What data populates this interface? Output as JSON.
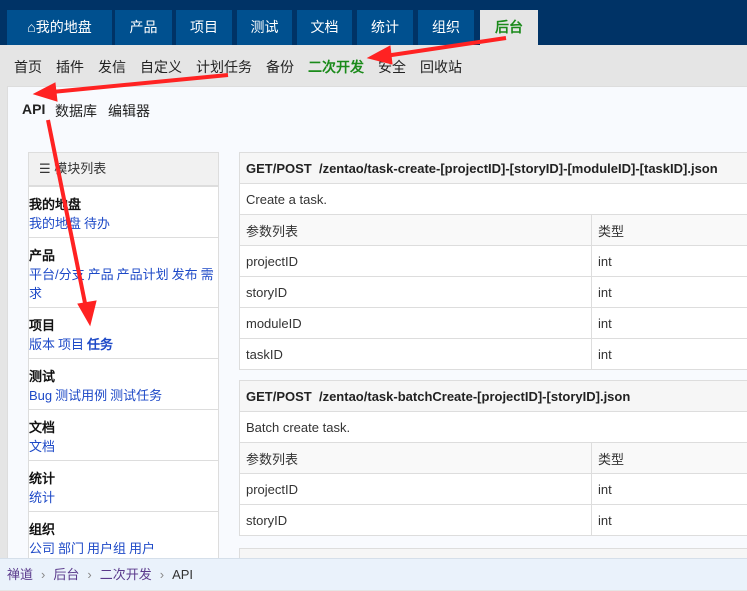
{
  "top_tabs": [
    "我的地盘",
    "产品",
    "项目",
    "测试",
    "文档",
    "统计",
    "组织",
    "后台"
  ],
  "active_tab": "后台",
  "sub_nav": [
    "首页",
    "插件",
    "发信",
    "自定义",
    "计划任务",
    "备份",
    "二次开发",
    "安全",
    "回收站"
  ],
  "active_sub": "二次开发",
  "dev_tabs": [
    "API",
    "数据库",
    "编辑器"
  ],
  "sidebar": {
    "title": "模块列表",
    "sections": [
      {
        "title": "我的地盘",
        "links": [
          "我的地盘",
          "待办"
        ]
      },
      {
        "title": "产品",
        "links": [
          "平台/分支",
          "产品",
          "产品计划",
          "发布",
          "需求"
        ]
      },
      {
        "title": "项目",
        "links": [
          "版本",
          "项目",
          "任务"
        ]
      },
      {
        "title": "测试",
        "links": [
          "Bug",
          "测试用例",
          "测试任务"
        ]
      },
      {
        "title": "文档",
        "links": [
          "文档"
        ]
      },
      {
        "title": "统计",
        "links": [
          "统计"
        ]
      },
      {
        "title": "组织",
        "links": [
          "公司",
          "部门",
          "用户组",
          "用户"
        ]
      }
    ]
  },
  "apis": [
    {
      "method": "GET/POST",
      "path": "/zentao/task-create-[projectID]-[storyID]-[moduleID]-[taskID].json",
      "desc": "Create a task.",
      "col_param": "参数列表",
      "col_type": "类型",
      "params": [
        {
          "name": "projectID",
          "type": "int"
        },
        {
          "name": "storyID",
          "type": "int"
        },
        {
          "name": "moduleID",
          "type": "int"
        },
        {
          "name": "taskID",
          "type": "int"
        }
      ]
    },
    {
      "method": "GET/POST",
      "path": "/zentao/task-batchCreate-[projectID]-[storyID].json",
      "desc": "Batch create task.",
      "col_param": "参数列表",
      "col_type": "类型",
      "params": [
        {
          "name": "projectID",
          "type": "int"
        },
        {
          "name": "storyID",
          "type": "int"
        }
      ]
    }
  ],
  "breadcrumb": [
    "禅道",
    "后台",
    "二次开发",
    "API"
  ],
  "colors": {
    "topbar": "#003366",
    "tab": "#00508f",
    "active": "#1a8a1a",
    "link": "#1d49c7",
    "arrow": "#f22"
  }
}
